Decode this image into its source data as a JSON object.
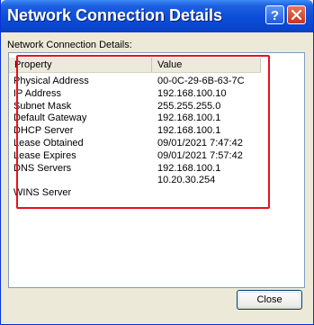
{
  "window": {
    "title": "Network Connection Details"
  },
  "dialog": {
    "section_label": "Network Connection Details:",
    "columns": [
      "Property",
      "Value"
    ],
    "rows": [
      {
        "name": "Physical Address",
        "value": "00-0C-29-6B-63-7C"
      },
      {
        "name": "IP Address",
        "value": "192.168.100.10"
      },
      {
        "name": "Subnet Mask",
        "value": "255.255.255.0"
      },
      {
        "name": "Default Gateway",
        "value": "192.168.100.1"
      },
      {
        "name": "DHCP Server",
        "value": "192.168.100.1"
      },
      {
        "name": "Lease Obtained",
        "value": "09/01/2021 7:47:42"
      },
      {
        "name": "Lease Expires",
        "value": "09/01/2021 7:57:42"
      },
      {
        "name": "DNS Servers",
        "value": "192.168.100.1"
      },
      {
        "name": "",
        "value": "10.20.30.254"
      },
      {
        "name": "WINS Server",
        "value": ""
      }
    ],
    "close_label": "Close"
  },
  "colors": {
    "titlebar": "#0c4fd9",
    "highlight": "#e8101c",
    "close_titlebar_button": "#c7361a"
  },
  "icons": {
    "help": "help-icon",
    "close": "close-icon"
  }
}
